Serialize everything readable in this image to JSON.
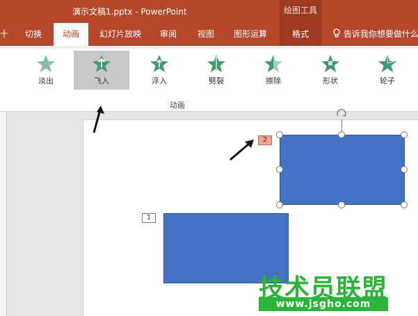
{
  "title_bar": {
    "doc_title": "演示文稿1.pptx  -  PowerPoint",
    "contextual_header": "绘图工具"
  },
  "tabs": {
    "partial_left": "十",
    "items": [
      {
        "label": "切换"
      },
      {
        "label": "动画"
      },
      {
        "label": "幻灯片放映"
      },
      {
        "label": "审阅"
      },
      {
        "label": "视图"
      },
      {
        "label": "图形运算"
      },
      {
        "label": "格式"
      }
    ],
    "tell_me": "告诉我你想要做什么"
  },
  "ribbon": {
    "group_label": "动画",
    "animations": [
      {
        "label": "淡出",
        "icon": "star-fade-icon"
      },
      {
        "label": "飞入",
        "icon": "star-fly-in-icon"
      },
      {
        "label": "浮入",
        "icon": "star-float-in-icon"
      },
      {
        "label": "劈裂",
        "icon": "star-split-icon"
      },
      {
        "label": "擦除",
        "icon": "star-wipe-icon"
      },
      {
        "label": "形状",
        "icon": "star-shape-icon"
      },
      {
        "label": "轮子",
        "icon": "star-wheel-icon"
      }
    ],
    "selected_index": 1
  },
  "slide": {
    "tag_1": "1",
    "tag_2": "2"
  },
  "colors": {
    "accent": "#b7472a",
    "contextual": "#9d3a21",
    "shape_fill": "#4472c4",
    "star_green": "#3f9b6a",
    "watermark": "#2db339"
  },
  "watermark": {
    "text": "技术员联盟",
    "url": "www.jsgho.com"
  }
}
